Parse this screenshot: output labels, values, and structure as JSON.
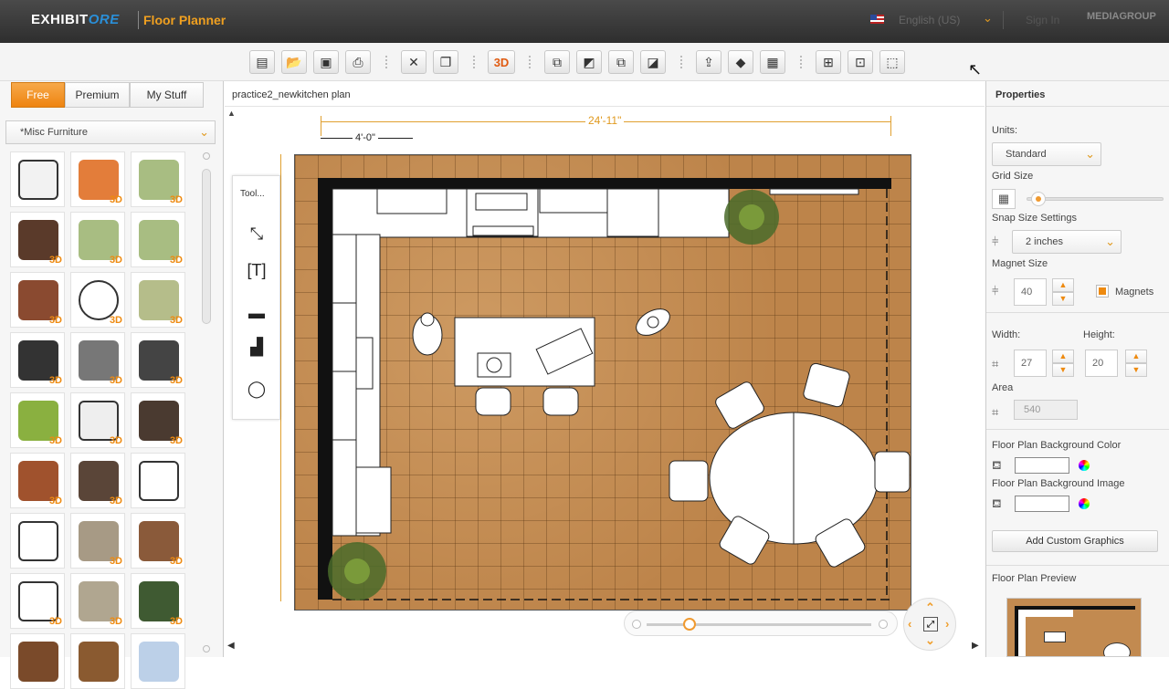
{
  "header": {
    "logo_text_1": "EXHIBIT",
    "logo_text_2": "ORE",
    "app_title": "Floor Planner",
    "language": "English (US)",
    "sign_in": "Sign In",
    "partner_logo": "MEDIAGROUP"
  },
  "toolbar": {
    "three_d_label": "3D",
    "buttons": [
      "new-document",
      "open-folder",
      "save",
      "print",
      "close",
      "copy",
      "3d",
      "arrange-front",
      "arrange-forward",
      "arrange-backward",
      "arrange-back",
      "share",
      "layers",
      "calculator",
      "select-all",
      "group",
      "select"
    ]
  },
  "library": {
    "tabs": [
      "Free",
      "Premium",
      "My Stuff"
    ],
    "active_tab": "Free",
    "category": "*Misc Furniture",
    "badge": "3D",
    "items": [
      {
        "icon": "armchair-outline-icon",
        "badge": false
      },
      {
        "icon": "orange-table-icon",
        "badge": true
      },
      {
        "icon": "green-ottoman-icon",
        "badge": true
      },
      {
        "icon": "glass-table-icon",
        "badge": true
      },
      {
        "icon": "green-stool-icon",
        "badge": true
      },
      {
        "icon": "green-ottoman-round-icon",
        "badge": true
      },
      {
        "icon": "bar-stool-icon",
        "badge": true
      },
      {
        "icon": "round-rug-icon",
        "badge": true
      },
      {
        "icon": "green-sofa-icon",
        "badge": true
      },
      {
        "icon": "oval-back-chair-icon",
        "badge": true
      },
      {
        "icon": "bed-icon",
        "badge": true
      },
      {
        "icon": "tall-bar-stool-icon",
        "badge": true
      },
      {
        "icon": "green-lounge-chair-icon",
        "badge": true
      },
      {
        "icon": "white-coffee-table-icon",
        "badge": true
      },
      {
        "icon": "media-console-icon",
        "badge": true
      },
      {
        "icon": "sideboard-icon",
        "badge": true
      },
      {
        "icon": "lounge-chair-brown-icon",
        "badge": true
      },
      {
        "icon": "curved-sofa-outline-icon",
        "badge": false
      },
      {
        "icon": "armchair-outline-2-icon",
        "badge": false
      },
      {
        "icon": "beige-armchair-icon",
        "badge": true
      },
      {
        "icon": "wood-coffee-table-icon",
        "badge": true
      },
      {
        "icon": "dotted-rug-icon",
        "badge": true
      },
      {
        "icon": "beige-sofa-icon",
        "badge": true
      },
      {
        "icon": "green-sofa-2-icon",
        "badge": true
      },
      {
        "icon": "wood-desk-icon",
        "badge": false
      },
      {
        "icon": "wood-chair-icon",
        "badge": false
      },
      {
        "icon": "blue-item-icon",
        "badge": false
      }
    ]
  },
  "canvas": {
    "plan_name": "practice2_newkitchen plan",
    "overall_dimension": "24'-11\"",
    "small_dimension": "4'-0\"",
    "tool_label": "Tool...",
    "text_tool": "[T]"
  },
  "properties": {
    "title": "Properties",
    "units_label": "Units:",
    "units_value": "Standard",
    "grid_size_label": "Grid Size",
    "snap_label": "Snap Size Settings",
    "snap_value": "2 inches",
    "magnet_label": "Magnet Size",
    "magnet_value": "40",
    "magnets_checkbox": "Magnets",
    "width_label": "Width:",
    "width_value": "27",
    "height_label": "Height:",
    "height_value": "20",
    "area_label": "Area",
    "area_value": "540",
    "bg_color_label": "Floor Plan Background Color",
    "bg_image_label": "Floor Plan Background Image",
    "add_custom_label": "Add Custom Graphics",
    "preview_label": "Floor Plan Preview"
  },
  "colors": {
    "accent": "#ee8a10",
    "floor": "#bd844a",
    "dimension": "#e0a030"
  }
}
